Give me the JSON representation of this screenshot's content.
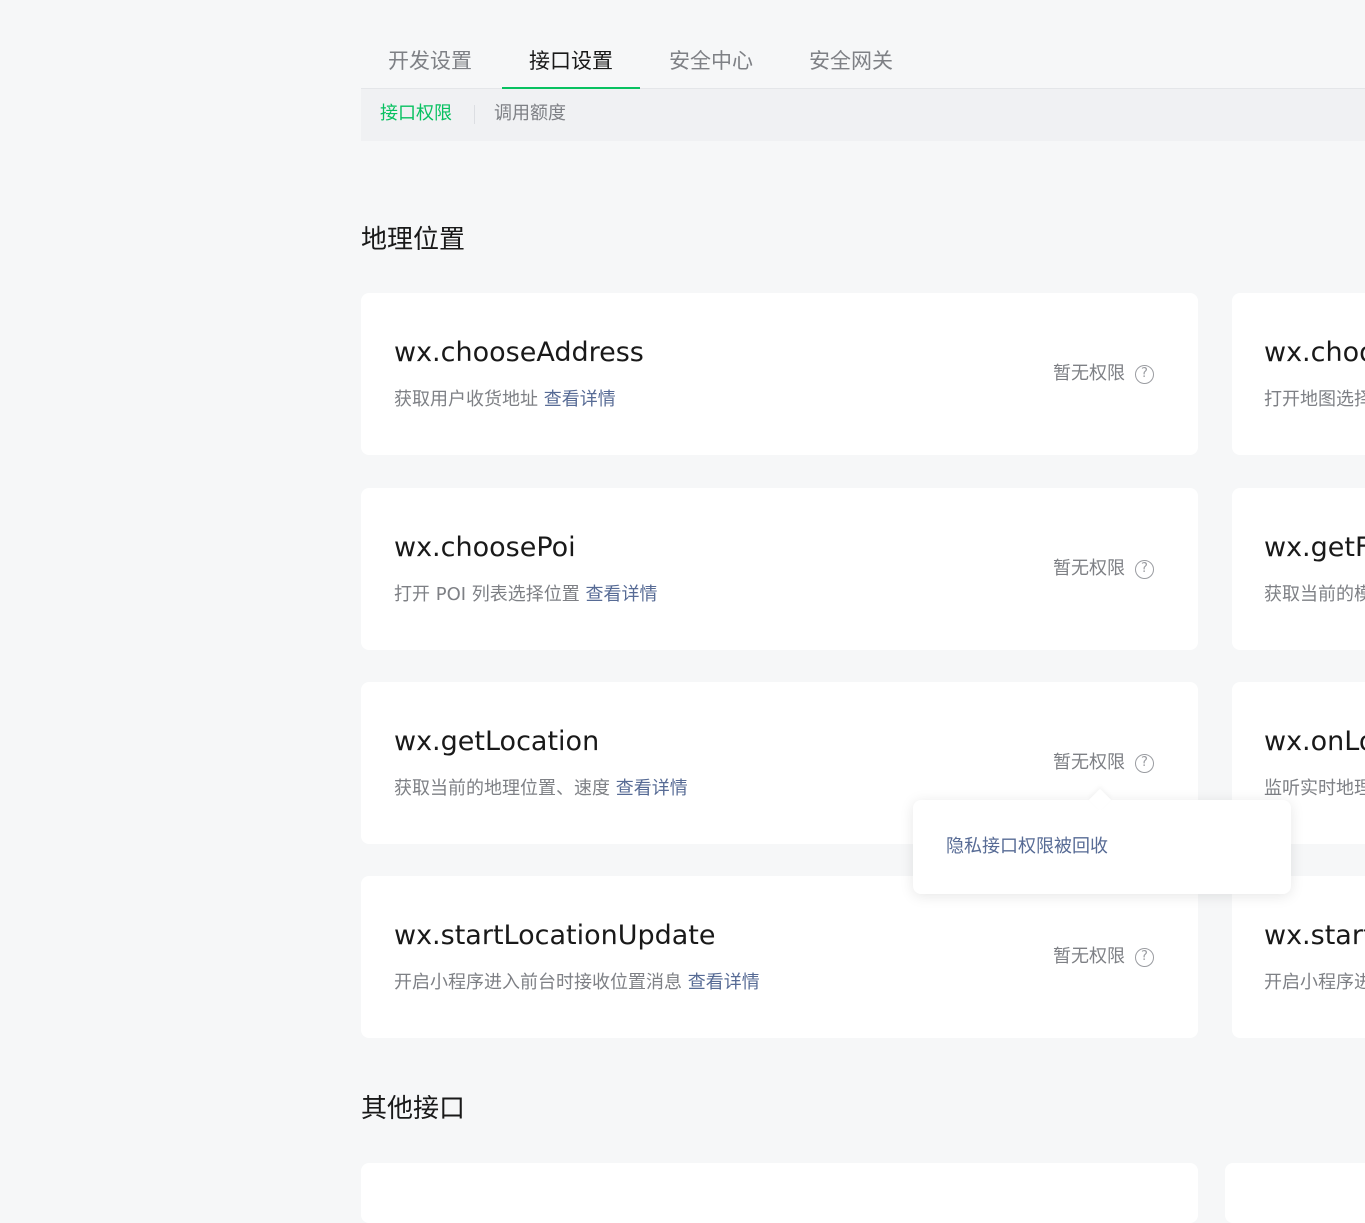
{
  "tabs": [
    {
      "label": "开发设置"
    },
    {
      "label": "接口设置"
    },
    {
      "label": "安全中心"
    },
    {
      "label": "安全网关"
    }
  ],
  "subtabs": [
    {
      "label": "接口权限"
    },
    {
      "label": "调用额度"
    }
  ],
  "sections": {
    "geo_title": "地理位置",
    "other_title": "其他接口"
  },
  "detail_link": "查看详情",
  "no_permission": "暂无权限",
  "apis": [
    {
      "name": "wx.chooseAddress",
      "desc": "获取用户收货地址"
    },
    {
      "name": "wx.choosePoi",
      "desc": "打开 POI 列表选择位置"
    },
    {
      "name": "wx.getLocation",
      "desc": "获取当前的地理位置、速度"
    },
    {
      "name": "wx.startLocationUpdate",
      "desc": "开启小程序进入前台时接收位置消息"
    }
  ],
  "side_apis": [
    {
      "name": "wx.choo",
      "desc": "打开地图选择"
    },
    {
      "name": "wx.getFu",
      "desc": "获取当前的模"
    },
    {
      "name": "wx.onLo",
      "desc": "监听实时地理"
    },
    {
      "name": "wx.start",
      "desc": "开启小程序进"
    }
  ],
  "tooltip": {
    "text": "隐私接口权限被回收"
  },
  "colors": {
    "accent": "#07c160",
    "link": "#576b95",
    "muted": "#7e8085"
  }
}
